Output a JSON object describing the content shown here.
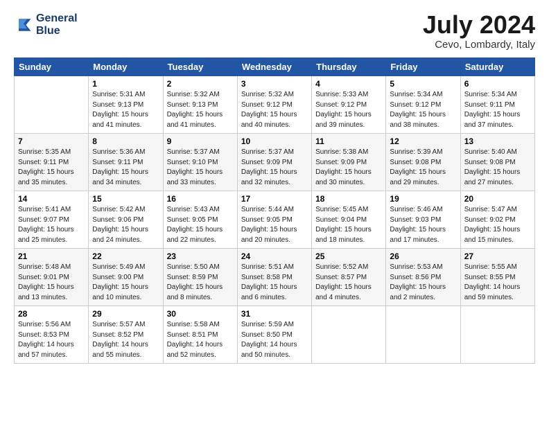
{
  "header": {
    "logo_line1": "General",
    "logo_line2": "Blue",
    "month_year": "July 2024",
    "location": "Cevo, Lombardy, Italy"
  },
  "days_of_week": [
    "Sunday",
    "Monday",
    "Tuesday",
    "Wednesday",
    "Thursday",
    "Friday",
    "Saturday"
  ],
  "weeks": [
    [
      {
        "day": "",
        "info": ""
      },
      {
        "day": "1",
        "info": "Sunrise: 5:31 AM\nSunset: 9:13 PM\nDaylight: 15 hours\nand 41 minutes."
      },
      {
        "day": "2",
        "info": "Sunrise: 5:32 AM\nSunset: 9:13 PM\nDaylight: 15 hours\nand 41 minutes."
      },
      {
        "day": "3",
        "info": "Sunrise: 5:32 AM\nSunset: 9:12 PM\nDaylight: 15 hours\nand 40 minutes."
      },
      {
        "day": "4",
        "info": "Sunrise: 5:33 AM\nSunset: 9:12 PM\nDaylight: 15 hours\nand 39 minutes."
      },
      {
        "day": "5",
        "info": "Sunrise: 5:34 AM\nSunset: 9:12 PM\nDaylight: 15 hours\nand 38 minutes."
      },
      {
        "day": "6",
        "info": "Sunrise: 5:34 AM\nSunset: 9:11 PM\nDaylight: 15 hours\nand 37 minutes."
      }
    ],
    [
      {
        "day": "7",
        "info": "Sunrise: 5:35 AM\nSunset: 9:11 PM\nDaylight: 15 hours\nand 35 minutes."
      },
      {
        "day": "8",
        "info": "Sunrise: 5:36 AM\nSunset: 9:11 PM\nDaylight: 15 hours\nand 34 minutes."
      },
      {
        "day": "9",
        "info": "Sunrise: 5:37 AM\nSunset: 9:10 PM\nDaylight: 15 hours\nand 33 minutes."
      },
      {
        "day": "10",
        "info": "Sunrise: 5:37 AM\nSunset: 9:09 PM\nDaylight: 15 hours\nand 32 minutes."
      },
      {
        "day": "11",
        "info": "Sunrise: 5:38 AM\nSunset: 9:09 PM\nDaylight: 15 hours\nand 30 minutes."
      },
      {
        "day": "12",
        "info": "Sunrise: 5:39 AM\nSunset: 9:08 PM\nDaylight: 15 hours\nand 29 minutes."
      },
      {
        "day": "13",
        "info": "Sunrise: 5:40 AM\nSunset: 9:08 PM\nDaylight: 15 hours\nand 27 minutes."
      }
    ],
    [
      {
        "day": "14",
        "info": "Sunrise: 5:41 AM\nSunset: 9:07 PM\nDaylight: 15 hours\nand 25 minutes."
      },
      {
        "day": "15",
        "info": "Sunrise: 5:42 AM\nSunset: 9:06 PM\nDaylight: 15 hours\nand 24 minutes."
      },
      {
        "day": "16",
        "info": "Sunrise: 5:43 AM\nSunset: 9:05 PM\nDaylight: 15 hours\nand 22 minutes."
      },
      {
        "day": "17",
        "info": "Sunrise: 5:44 AM\nSunset: 9:05 PM\nDaylight: 15 hours\nand 20 minutes."
      },
      {
        "day": "18",
        "info": "Sunrise: 5:45 AM\nSunset: 9:04 PM\nDaylight: 15 hours\nand 18 minutes."
      },
      {
        "day": "19",
        "info": "Sunrise: 5:46 AM\nSunset: 9:03 PM\nDaylight: 15 hours\nand 17 minutes."
      },
      {
        "day": "20",
        "info": "Sunrise: 5:47 AM\nSunset: 9:02 PM\nDaylight: 15 hours\nand 15 minutes."
      }
    ],
    [
      {
        "day": "21",
        "info": "Sunrise: 5:48 AM\nSunset: 9:01 PM\nDaylight: 15 hours\nand 13 minutes."
      },
      {
        "day": "22",
        "info": "Sunrise: 5:49 AM\nSunset: 9:00 PM\nDaylight: 15 hours\nand 10 minutes."
      },
      {
        "day": "23",
        "info": "Sunrise: 5:50 AM\nSunset: 8:59 PM\nDaylight: 15 hours\nand 8 minutes."
      },
      {
        "day": "24",
        "info": "Sunrise: 5:51 AM\nSunset: 8:58 PM\nDaylight: 15 hours\nand 6 minutes."
      },
      {
        "day": "25",
        "info": "Sunrise: 5:52 AM\nSunset: 8:57 PM\nDaylight: 15 hours\nand 4 minutes."
      },
      {
        "day": "26",
        "info": "Sunrise: 5:53 AM\nSunset: 8:56 PM\nDaylight: 15 hours\nand 2 minutes."
      },
      {
        "day": "27",
        "info": "Sunrise: 5:55 AM\nSunset: 8:55 PM\nDaylight: 14 hours\nand 59 minutes."
      }
    ],
    [
      {
        "day": "28",
        "info": "Sunrise: 5:56 AM\nSunset: 8:53 PM\nDaylight: 14 hours\nand 57 minutes."
      },
      {
        "day": "29",
        "info": "Sunrise: 5:57 AM\nSunset: 8:52 PM\nDaylight: 14 hours\nand 55 minutes."
      },
      {
        "day": "30",
        "info": "Sunrise: 5:58 AM\nSunset: 8:51 PM\nDaylight: 14 hours\nand 52 minutes."
      },
      {
        "day": "31",
        "info": "Sunrise: 5:59 AM\nSunset: 8:50 PM\nDaylight: 14 hours\nand 50 minutes."
      },
      {
        "day": "",
        "info": ""
      },
      {
        "day": "",
        "info": ""
      },
      {
        "day": "",
        "info": ""
      }
    ]
  ]
}
